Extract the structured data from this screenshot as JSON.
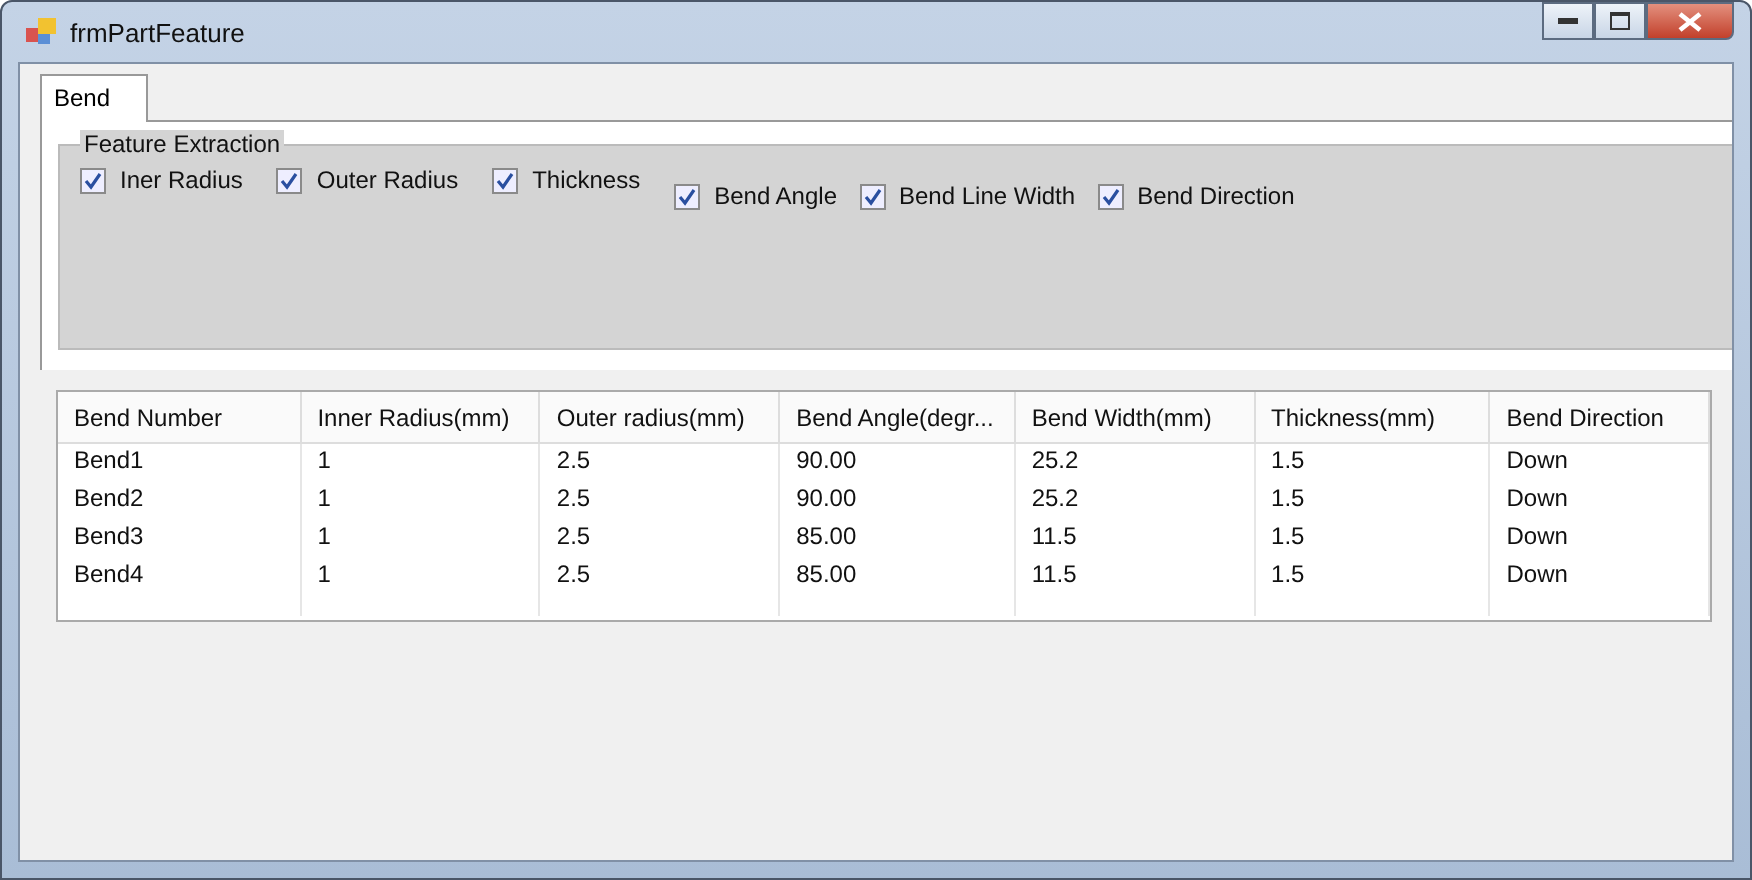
{
  "window": {
    "title": "frmPartFeature"
  },
  "tabs": [
    {
      "label": "Bend",
      "selected": true
    }
  ],
  "group": {
    "title": "Feature Extraction",
    "options": [
      {
        "label": "Iner Radius",
        "checked": true
      },
      {
        "label": "Outer Radius",
        "checked": true
      },
      {
        "label": "Thickness",
        "checked": true
      },
      {
        "label": "Bend Angle",
        "checked": true
      },
      {
        "label": "Bend Line Width",
        "checked": true
      },
      {
        "label": "Bend Direction",
        "checked": true
      }
    ]
  },
  "table": {
    "columns": [
      "Bend Number",
      "Inner Radius(mm)",
      "Outer radius(mm)",
      "Bend Angle(degr...",
      "Bend Width(mm)",
      "Thickness(mm)",
      "Bend Direction"
    ],
    "rows": [
      [
        "Bend1",
        "1",
        "2.5",
        "90.00",
        "25.2",
        "1.5",
        "Down"
      ],
      [
        "Bend2",
        "1",
        "2.5",
        "90.00",
        "25.2",
        "1.5",
        "Down"
      ],
      [
        "Bend3",
        "1",
        "2.5",
        "85.00",
        "11.5",
        "1.5",
        "Down"
      ],
      [
        "Bend4",
        "1",
        "2.5",
        "85.00",
        "11.5",
        "1.5",
        "Down"
      ]
    ]
  }
}
